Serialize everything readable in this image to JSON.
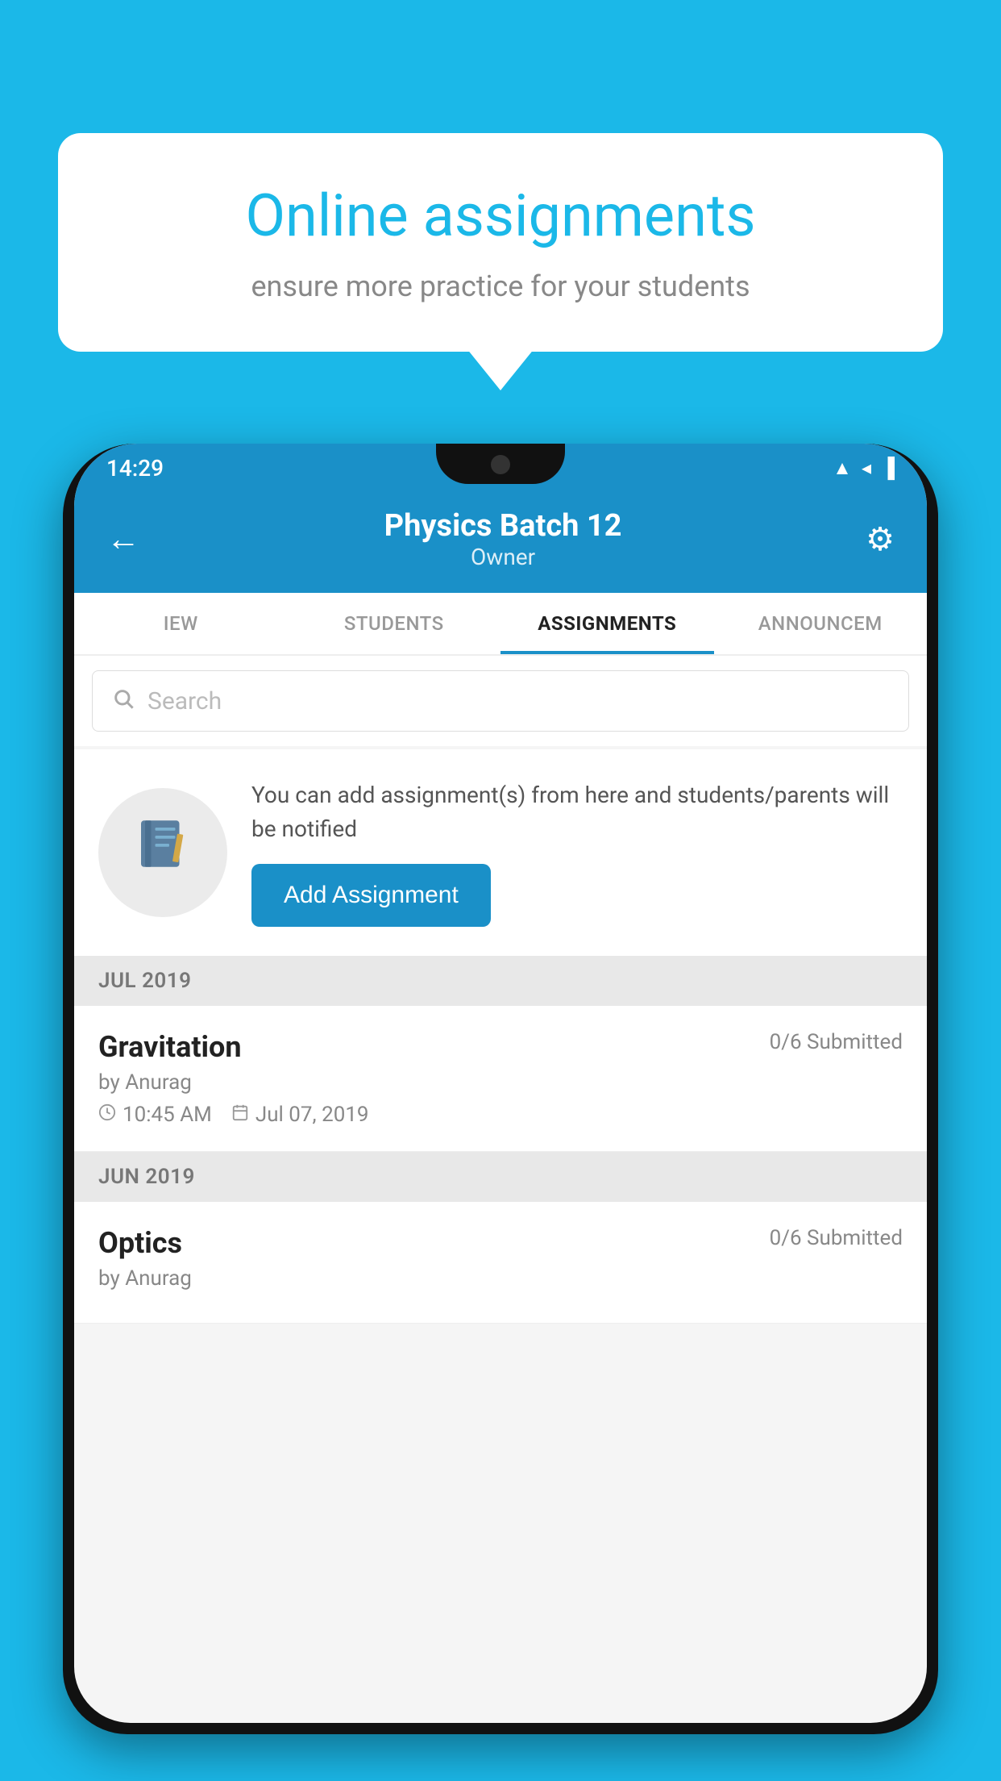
{
  "background": {
    "color": "#1bb8e8"
  },
  "speech_bubble": {
    "title": "Online assignments",
    "subtitle": "ensure more practice for your students"
  },
  "status_bar": {
    "time": "14:29",
    "icons": [
      "wifi",
      "signal",
      "battery"
    ]
  },
  "header": {
    "title": "Physics Batch 12",
    "subtitle": "Owner",
    "back_label": "←",
    "settings_label": "⚙"
  },
  "tabs": [
    {
      "label": "IEW",
      "active": false
    },
    {
      "label": "STUDENTS",
      "active": false
    },
    {
      "label": "ASSIGNMENTS",
      "active": true
    },
    {
      "label": "ANNOUNCEM",
      "active": false
    }
  ],
  "search": {
    "placeholder": "Search"
  },
  "info_section": {
    "text": "You can add assignment(s) from here and students/parents will be notified",
    "button_label": "Add Assignment"
  },
  "sections": [
    {
      "label": "JUL 2019",
      "assignments": [
        {
          "name": "Gravitation",
          "submitted": "0/6 Submitted",
          "author": "by Anurag",
          "time": "10:45 AM",
          "date": "Jul 07, 2019"
        }
      ]
    },
    {
      "label": "JUN 2019",
      "assignments": [
        {
          "name": "Optics",
          "submitted": "0/6 Submitted",
          "author": "by Anurag",
          "time": "",
          "date": ""
        }
      ]
    }
  ]
}
